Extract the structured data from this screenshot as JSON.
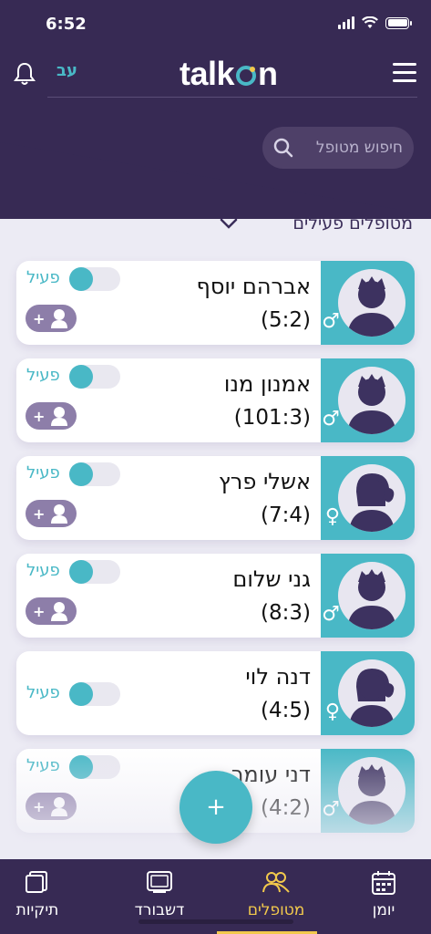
{
  "status_bar": {
    "time": "6:52"
  },
  "header": {
    "lang_label": "עב",
    "logo": "talk",
    "logo_suffix": "n",
    "search_placeholder": "חיפוש מטופל"
  },
  "filter": {
    "label": "מטופלים פעילים"
  },
  "colors": {
    "primary": "#372a54",
    "accent": "#49b8c6",
    "active_tab": "#f2c94c",
    "pill": "#8d7ea9"
  },
  "patients": [
    {
      "name": "אברהם יוסף",
      "code": "(5:2)",
      "gender": "♂",
      "status": "פעיל",
      "add": "+"
    },
    {
      "name": "אמנון מנו",
      "code": "(101:3)",
      "gender": "♂",
      "status": "פעיל",
      "add": "+"
    },
    {
      "name": "אשלי פרץ",
      "code": "(7:4)",
      "gender": "♀",
      "status": "פעיל",
      "add": "+"
    },
    {
      "name": "גני שלום",
      "code": "(8:3)",
      "gender": "♂",
      "status": "פעיל",
      "add": "+"
    },
    {
      "name": "דנה לוי",
      "code": "(4:5)",
      "gender": "♀",
      "status": "פעיל"
    },
    {
      "name": "דני עומר",
      "code": "(4:2)",
      "gender": "♂",
      "status": "פעיל",
      "add": "+"
    }
  ],
  "fab_label": "+",
  "nav": {
    "folders": "תיקיות",
    "dashboard": "דשבורד",
    "patients": "מטופלים",
    "diary": "יומן"
  }
}
